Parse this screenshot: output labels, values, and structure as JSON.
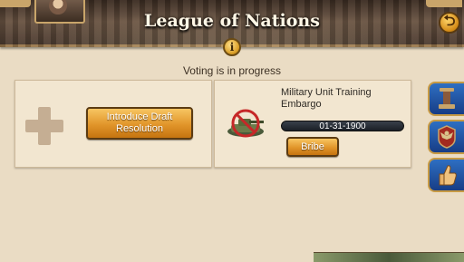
{
  "header": {
    "title": "League of Nations"
  },
  "info_button": {
    "glyph": "i"
  },
  "back_button": {
    "glyph": "⮌"
  },
  "status": {
    "text": "Voting is in progress"
  },
  "left_panel": {
    "icon": "plus-icon",
    "button_label": "Introduce Draft Resolution"
  },
  "proposal": {
    "icon": "tank-prohibited-icon",
    "title": "Military Unit Training Embargo",
    "date": "01-31-1900",
    "bribe_label": "Bribe"
  },
  "side_tabs": [
    {
      "icon": "pedestal-icon"
    },
    {
      "icon": "eagle-emblem-icon"
    },
    {
      "icon": "thumbs-up-icon"
    }
  ],
  "colors": {
    "accent_orange": "#e1952a",
    "tab_blue": "#2e6fc2",
    "panel_bg": "#f2e6d0",
    "page_bg": "#eadcc4"
  }
}
